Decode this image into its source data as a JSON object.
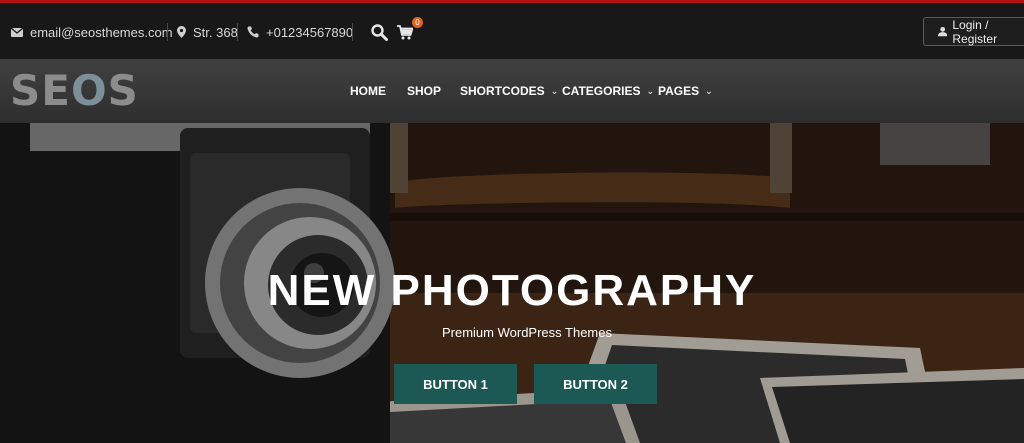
{
  "topbar": {
    "email": "email@seosthemes.com",
    "address": "Str. 368",
    "phone": "+01234567890",
    "cart_count": "0",
    "login_label": "Login / Register"
  },
  "logo": {
    "text_left": "SE",
    "text_o": "O",
    "text_right": "S"
  },
  "nav": {
    "items": [
      {
        "label": "HOME"
      },
      {
        "label": "SHOP"
      },
      {
        "label": "SHORTCODES"
      },
      {
        "label": "CATEGORIES"
      },
      {
        "label": "PAGES"
      }
    ],
    "chevron": "⌄"
  },
  "hero": {
    "title": "NEW PHOTOGRAPHY",
    "subtitle": "Premium WordPress Themes",
    "button1": "BUTTON 1",
    "button2": "BUTTON 2"
  },
  "colors": {
    "accent_red": "#b01010",
    "button_teal": "#1c5954",
    "cart_badge": "#e0641e"
  }
}
